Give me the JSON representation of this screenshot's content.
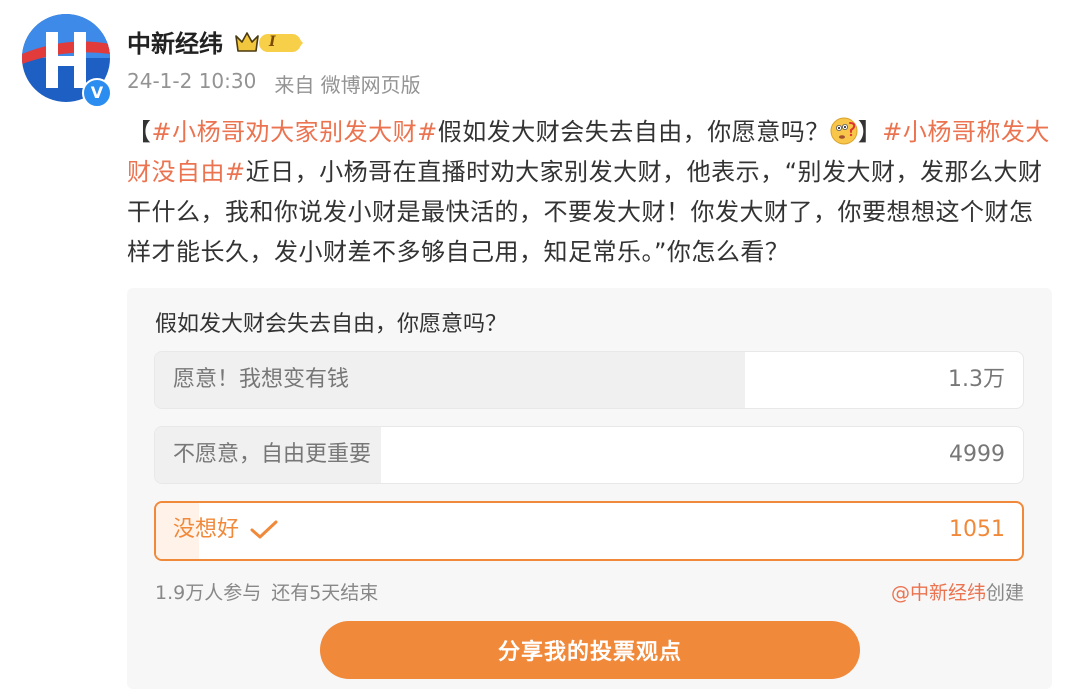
{
  "post": {
    "author": "中新经纬",
    "rank_badge": "I",
    "verified_mark": "V",
    "time": "24-1-2 10:30",
    "source": "来自 微博网页版"
  },
  "content": {
    "topic1": "#小杨哥劝大家别发大财#",
    "text1": "假如发大财会失去自由，你愿意吗？",
    "bracket_open": "【",
    "bracket_close": "】",
    "topic2": "#小杨哥称发大财没自由#",
    "text2": "近日，小杨哥在直播时劝大家别发大财，他表示，“别发大财，发那么大财干什么，我和你说发小财是最快活的，不要发大财！你发大财了，你要想想这个财怎样才能长久，发小财差不多够自己用，知足常乐。”你怎么看？",
    "emoji_icon": "thinking-face-icon"
  },
  "poll": {
    "question": "假如发大财会失去自由，你愿意吗？",
    "options": [
      {
        "label": "愿意！我想变有钱",
        "count": "1.3万",
        "share": 0.68,
        "selected": false
      },
      {
        "label": "不愿意，自由更重要",
        "count": "4999",
        "share": 0.26,
        "selected": false
      },
      {
        "label": "没想好",
        "count": "1051",
        "share": 0.05,
        "selected": true
      }
    ],
    "participants": "1.9万人参与",
    "remaining": "还有5天结束",
    "creator_mention": "@中新经纬",
    "creator_suffix": "创建",
    "share_button": "分享我的投票观点"
  },
  "colors": {
    "accent": "#f0893a",
    "topic": "#eb7350",
    "verified": "#2b8df0"
  }
}
